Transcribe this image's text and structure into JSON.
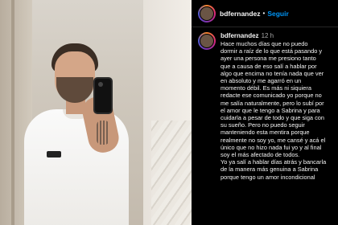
{
  "post": {
    "username": "bdfernandez",
    "separator": "•",
    "follow_label": "Seguir"
  },
  "caption": {
    "username": "bdfernandez",
    "time": "12 h",
    "text": "Hace muchos días que no puedo\ndormir a raíz de lo que está pasando y\nayer una persona me presiono tanto\nque a causa de eso salí a hablar por\nalgo que encima no tenía nada que ver\nen absoluto y me agarró en un\nmomento débil. Es más ni siquiera\nredacte ese comunicado yo porque no\nme salía naturalmente, pero lo subí por\nel amor que le tengo a Sabrina y para\ncuidarla a pesar de todo y que siga con\nsu sueño. Pero no puedo seguir\nmanteniendo esta mentira porque\nrealmente no soy yo, me cansé y acá el\núnico que no hizo nada fui yo y al final\nsoy el más afectado de todos.\nYo ya salí a hablar días atrás y bancarla\nde la manera más genuina a Sabrina\nporque tengo un amor incondicional"
  },
  "colors": {
    "background": "#000000",
    "follow": "#0095f6",
    "muted": "#a8a8a8"
  }
}
